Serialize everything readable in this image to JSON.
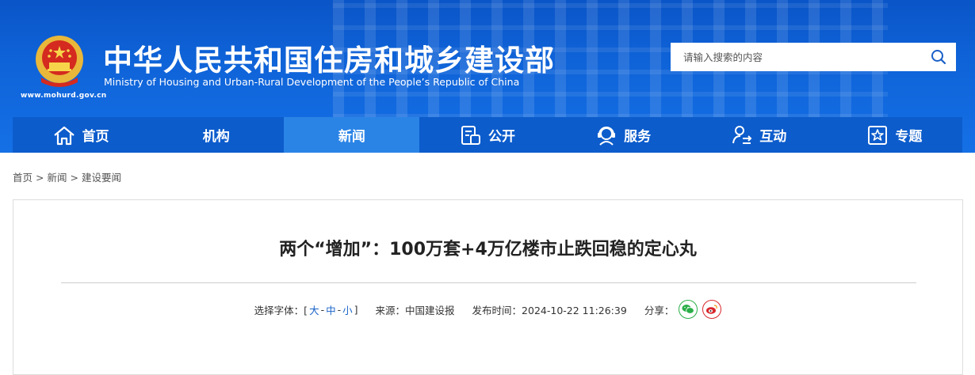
{
  "header": {
    "site_url": "www.mohurd.gov.cn",
    "title_cn": "中华人民共和国住房和城乡建设部",
    "title_en": "Ministry of Housing and Urban-Rural Development of the People’s Republic of China",
    "search_placeholder": "请输入搜索的内容",
    "emblem_icon": "national-emblem-icon",
    "search_icon": "search-icon"
  },
  "nav": {
    "items": [
      {
        "label": "首页",
        "icon": "home-icon"
      },
      {
        "label": "机构",
        "icon": ""
      },
      {
        "label": "新闻",
        "icon": "",
        "active": true
      },
      {
        "label": "公开",
        "icon": "document-icon"
      },
      {
        "label": "服务",
        "icon": "service-headset-icon"
      },
      {
        "label": "互动",
        "icon": "interaction-icon"
      },
      {
        "label": "专题",
        "icon": "star-icon"
      }
    ]
  },
  "breadcrumb": {
    "items": [
      "首页",
      "新闻",
      "建设要闻"
    ],
    "separator": ">"
  },
  "article": {
    "title": "两个“增加”：100万套+4万亿楼市止跌回稳的定心丸",
    "font_size_label": "选择字体：[",
    "font_size_large": "大",
    "font_size_medium": "中",
    "font_size_small": "小",
    "font_size_dash": "-",
    "font_size_close": "]",
    "source_label": "来源：中国建设报",
    "publish_label": "发布时间：2024-10-22 11:26:39",
    "share_label": "分享："
  },
  "colors": {
    "banner_blue": "#0f63d8",
    "nav_blue": "#0c5ccc",
    "nav_active": "#2a84e6",
    "link_blue": "#1a63c8",
    "wechat_green": "#2aae47",
    "weibo_red": "#d8262b"
  }
}
